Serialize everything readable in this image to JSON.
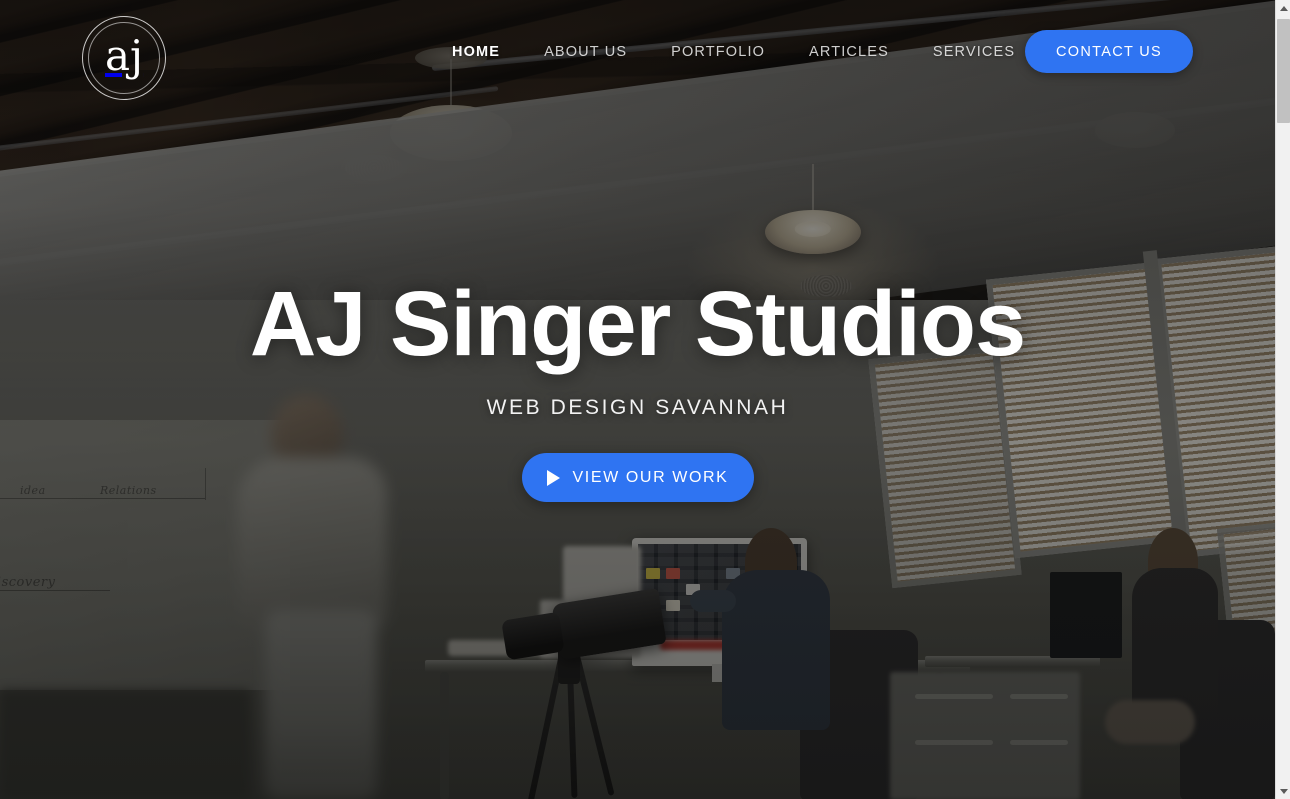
{
  "site": {
    "logo_mark": "aj",
    "logo_alt": "AJ Singer Studios monogram"
  },
  "header": {
    "nav": [
      {
        "label": "HOME",
        "name": "nav-link-home",
        "active": true
      },
      {
        "label": "ABOUT US",
        "name": "nav-link-about-us",
        "active": false
      },
      {
        "label": "PORTFOLIO",
        "name": "nav-link-portfolio",
        "active": false
      },
      {
        "label": "ARTICLES",
        "name": "nav-link-articles",
        "active": false
      },
      {
        "label": "SERVICES",
        "name": "nav-link-services",
        "active": false
      }
    ],
    "contact_button": "CONTACT US"
  },
  "hero": {
    "title": "AJ Singer Studios",
    "subtitle": "WEB DESIGN SAVANNAH",
    "cta_label": "VIEW OUR WORK",
    "cta_icon": "play-icon",
    "background_description": "Dark photo of an open-plan studio office with exposed wood ceiling beams, hanging dome pendant lamps, conduit piping, a blurred person walking past a whiteboard, a camera on a tripod, and two people working at desks near windows with blinds"
  },
  "whiteboard": {
    "notes": [
      "Discovery"
    ]
  },
  "colors": {
    "accent_blue": "#2f74f2",
    "text_white": "#ffffff",
    "nav_inactive": "rgba(255,255,255,0.80)",
    "scrollbar_track": "#f1f1f1",
    "scrollbar_thumb": "#c1c1c1"
  },
  "scrollbar": {
    "up_arrow": "scroll-up-arrow",
    "down_arrow": "scroll-down-arrow",
    "thumb": "scroll-thumb"
  }
}
